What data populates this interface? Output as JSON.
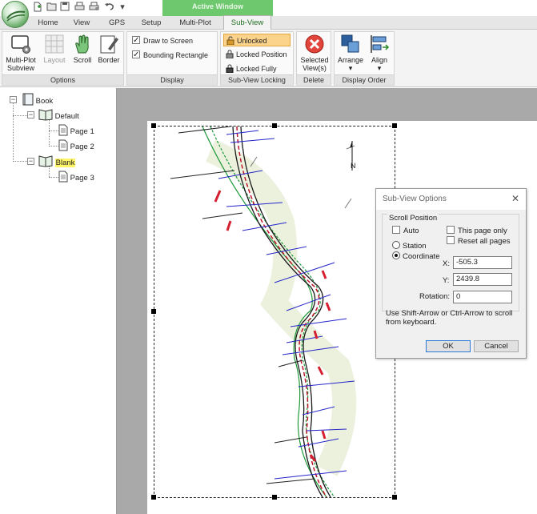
{
  "titlebar": {
    "active_window": "Active Window"
  },
  "quick_access": [
    "new-icon",
    "open-icon",
    "save-icon",
    "print-icon",
    "print-setup-icon",
    "undo-icon",
    "customize-icon"
  ],
  "tabs": [
    "Home",
    "View",
    "GPS",
    "Setup",
    "Multi-Plot",
    "Sub-View"
  ],
  "active_tab": "Sub-View",
  "ribbon": {
    "options": {
      "label": "Options",
      "multiplot": "Multi-Plot Subview",
      "layout": "Layout",
      "scroll": "Scroll",
      "border": "Border"
    },
    "display": {
      "label": "Display",
      "draw_to_screen": "Draw to Screen",
      "bounding_rect": "Bounding Rectangle"
    },
    "locking": {
      "label": "Sub-View Locking",
      "unlocked": "Unlocked",
      "locked_position": "Locked Position",
      "locked_fully": "Locked Fully"
    },
    "delete": {
      "label": "Delete",
      "selected": "Selected View(s)"
    },
    "order": {
      "label": "Display Order",
      "arrange": "Arrange",
      "align": "Align"
    }
  },
  "tree": {
    "root": "Book",
    "default": "Default",
    "page1": "Page 1",
    "page2": "Page 2",
    "blank": "Blank",
    "page3": "Page 3"
  },
  "map": {
    "north_label": "N"
  },
  "dialog": {
    "title": "Sub-View Options",
    "group_label": "Scroll Position",
    "auto": "Auto",
    "this_page_only": "This page only",
    "reset_all_pages": "Reset all pages",
    "station": "Station",
    "coordinate": "Coordinate",
    "x_label": "X:",
    "x_value": "-505.3",
    "y_label": "Y:",
    "y_value": "2439.8",
    "rotation_label": "Rotation:",
    "rotation_value": "0",
    "hint": "Use Shift-Arrow or Ctrl-Arrow to scroll from keyboard.",
    "ok": "OK",
    "cancel": "Cancel"
  },
  "colors": {
    "accent_green": "#6ec86e",
    "lock_highlight": "#fcd38a",
    "tree_highlight": "#fff568"
  }
}
